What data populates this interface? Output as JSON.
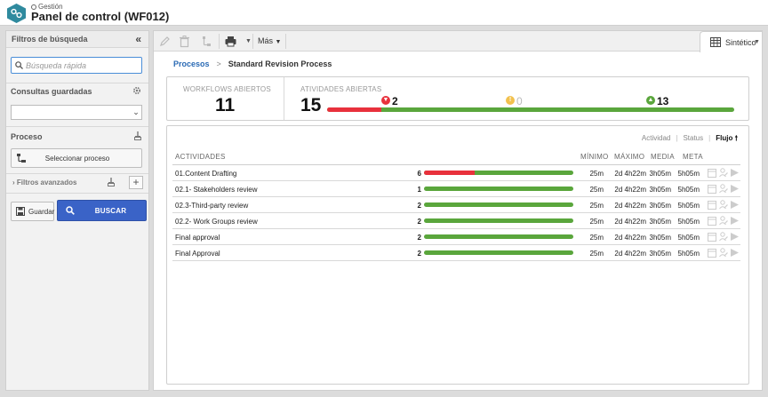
{
  "header": {
    "module": "Gestión",
    "title": "Panel de control (WF012)"
  },
  "sidebar": {
    "title": "Filtros de búsqueda",
    "search_placeholder": "Búsqueda rápida",
    "saved_queries_label": "Consultas guardadas",
    "saved_query_value": "",
    "process_label": "Proceso",
    "select_process_button": "Seleccionar proceso",
    "advanced_filters_label": "Filtros avanzados",
    "save_button": "Guardar",
    "search_button": "BUSCAR"
  },
  "toolbar": {
    "more_label": "Más",
    "view_label": "Sintético"
  },
  "breadcrumb": {
    "root": "Procesos",
    "current": "Standard Revision Process"
  },
  "kpi": {
    "workflows_label": "WORKFLOWS ABIERTOS",
    "workflows_value": "11",
    "activities_label": "ATIVIDADES ABIERTAS",
    "activities_value": "15",
    "late": "2",
    "warning": "0",
    "on_time": "13",
    "late_fraction": 0.133,
    "colors": {
      "late": "#e8313c",
      "warning": "#f2c14e",
      "on_time": "#5aa63c"
    }
  },
  "panel": {
    "tabs": [
      "Actividad",
      "Status",
      "Flujo"
    ],
    "active_tab": "Flujo",
    "columns": {
      "activity": "ACTIVIDADES",
      "min": "MÍNIMO",
      "max": "MÁXIMO",
      "avg": "MEDIA",
      "meta": "META"
    },
    "rows": [
      {
        "name": "01.Content Drafting",
        "count": "6",
        "late_fraction": 0.34,
        "min": "25m",
        "max": "2d 4h22m",
        "avg": "3h05m",
        "meta": "5h05m"
      },
      {
        "name": "02.1- Stakeholders review",
        "count": "1",
        "late_fraction": 0,
        "min": "25m",
        "max": "2d 4h22m",
        "avg": "3h05m",
        "meta": "5h05m"
      },
      {
        "name": "02.3-Third-party review",
        "count": "2",
        "late_fraction": 0,
        "min": "25m",
        "max": "2d 4h22m",
        "avg": "3h05m",
        "meta": "5h05m"
      },
      {
        "name": "02.2- Work Groups review",
        "count": "2",
        "late_fraction": 0,
        "min": "25m",
        "max": "2d 4h22m",
        "avg": "3h05m",
        "meta": "5h05m"
      },
      {
        "name": "Final approval",
        "count": "2",
        "late_fraction": 0,
        "min": "25m",
        "max": "2d 4h22m",
        "avg": "3h05m",
        "meta": "5h05m"
      },
      {
        "name": "Final Approval",
        "count": "2",
        "late_fraction": 0,
        "min": "25m",
        "max": "2d 4h22m",
        "avg": "3h05m",
        "meta": "5h05m"
      }
    ]
  },
  "icons": {
    "logo": "workflow-logo-icon",
    "crumb": "search-icon",
    "collapse": "double-chevron-left-icon",
    "gear": "gear-icon",
    "broom": "broom-icon",
    "edit": "pencil-icon",
    "delete": "trash-icon",
    "hierarchy": "hierarchy-icon",
    "print": "printer-icon",
    "view": "grid-view-icon"
  }
}
